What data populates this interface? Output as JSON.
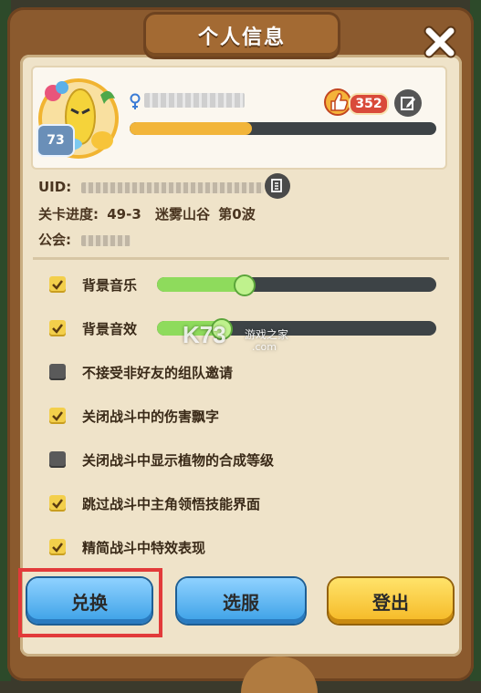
{
  "dialog": {
    "title": "个人信息"
  },
  "profile": {
    "level": "73",
    "likes": "352",
    "exp_progress": 0.4
  },
  "info": {
    "uid_label": "UID:",
    "stage_label": "关卡进度:",
    "stage_value": "49-3",
    "stage_name": "迷雾山谷",
    "wave": "第0波",
    "guild_label": "公会:"
  },
  "settings": [
    {
      "label": "背景音乐",
      "checked": true,
      "volume": 0.3
    },
    {
      "label": "背景音效",
      "checked": true,
      "volume": 0.22
    },
    {
      "label": "不接受非好友的组队邀请",
      "checked": false
    },
    {
      "label": "关闭战斗中的伤害飘字",
      "checked": true
    },
    {
      "label": "关闭战斗中显示植物的合成等级",
      "checked": false
    },
    {
      "label": "跳过战斗中主角领悟技能界面",
      "checked": true
    },
    {
      "label": "精简战斗中特效表现",
      "checked": true
    }
  ],
  "buttons": {
    "redeem": "兑换",
    "select_server": "选服",
    "logout": "登出"
  },
  "watermark": {
    "main": "K73",
    "sub": "游戏之家",
    "domain": ".com"
  },
  "colors": {
    "panel": "#8b5a2e",
    "inner": "#efe3c9",
    "accent_yellow": "#f3cf4b",
    "exp": "#f2b53a",
    "slider": "#8edb5c",
    "highlight": "#e23a3a"
  },
  "icons": [
    "close-icon",
    "gender-icon",
    "thumbs-up-icon",
    "edit-icon",
    "copy-icon",
    "check-icon"
  ]
}
